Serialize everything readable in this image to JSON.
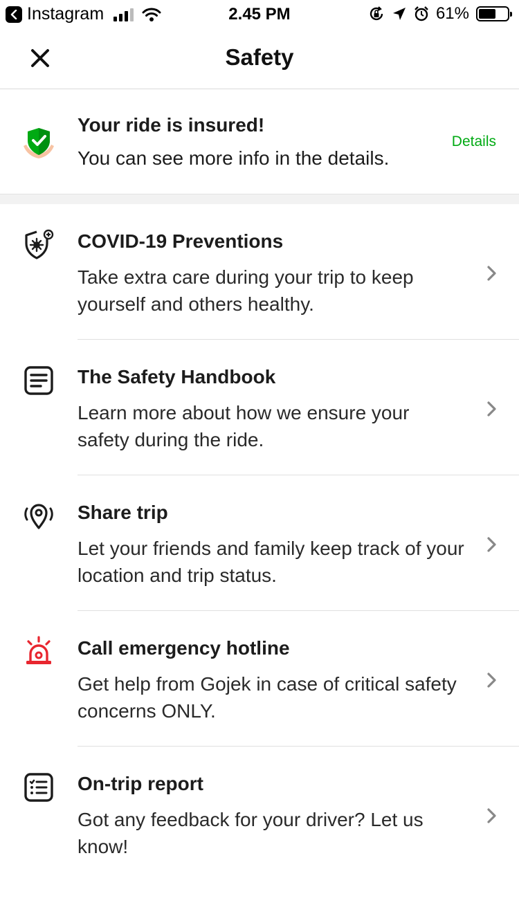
{
  "status_bar": {
    "back_app": "Instagram",
    "time": "2.45 PM",
    "battery": "61%",
    "battery_level": 0.61
  },
  "header": {
    "title": "Safety"
  },
  "insured": {
    "title": "Your ride is insured!",
    "description": "You can see more info in the details.",
    "link": "Details"
  },
  "items": [
    {
      "icon": "virus-shield-icon",
      "title": "COVID-19 Preventions",
      "description": "Take extra care during your trip to keep yourself and others healthy."
    },
    {
      "icon": "handbook-icon",
      "title": "The Safety Handbook",
      "description": "Learn more about how we ensure your safety during the ride."
    },
    {
      "icon": "share-location-icon",
      "title": "Share trip",
      "description": "Let your friends and family keep track of your location and trip status."
    },
    {
      "icon": "emergency-siren-icon",
      "title": "Call emergency hotline",
      "description": "Get help from Gojek in case of critical safety concerns ONLY."
    },
    {
      "icon": "report-list-icon",
      "title": "On-trip report",
      "description": "Got any feedback for your driver? Let us know!"
    }
  ],
  "colors": {
    "accent_green": "#00aa13",
    "emergency_red": "#e8262f",
    "text": "#1c1c1c"
  }
}
